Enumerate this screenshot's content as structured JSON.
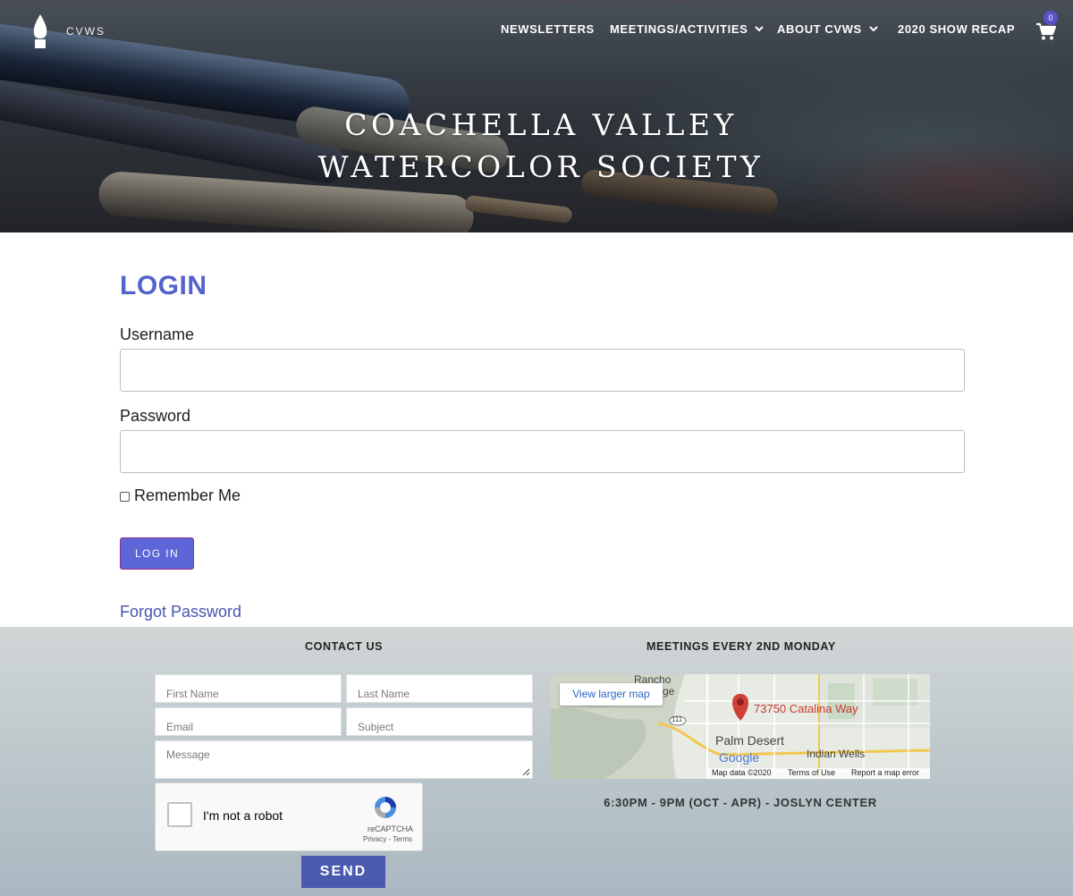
{
  "header": {
    "logo_text": "CVWS",
    "nav": [
      {
        "label": "NEWSLETTERS",
        "has_dropdown": false
      },
      {
        "label": "MEETINGS/ACTIVITIES",
        "has_dropdown": true
      },
      {
        "label": "ABOUT CVWS",
        "has_dropdown": true
      },
      {
        "label": "2020 SHOW RECAP",
        "has_dropdown": false
      }
    ],
    "cart_count": "0",
    "title_line1": "COACHELLA VALLEY",
    "title_line2": "WATERCOLOR SOCIETY"
  },
  "login": {
    "title": "LOGIN",
    "username_label": "Username",
    "username_value": "",
    "password_label": "Password",
    "password_value": "",
    "remember_label": "Remember Me",
    "remember_checked": false,
    "button_label": "LOG IN",
    "forgot_label": "Forgot Password"
  },
  "footer": {
    "contact_heading": "CONTACT US",
    "fields": {
      "first_name": "First Name",
      "last_name": "Last Name",
      "email": "Email",
      "subject": "Subject",
      "message": "Message"
    },
    "recaptcha": {
      "label": "I'm not a robot",
      "brand": "reCAPTCHA",
      "links": "Privacy - Terms"
    },
    "send_label": "SEND",
    "meetings_heading": "MEETINGS EVERY 2ND MONDAY",
    "map": {
      "view_larger": "View larger map",
      "address": "73750 Catalina Way",
      "city_palm_desert": "Palm Desert",
      "city_indian_wells": "Indian Wells",
      "city_rancho": "Rancho",
      "rancho_partial": "ge",
      "highway": "111",
      "google": "Google",
      "map_data": "Map data ©2020",
      "terms": "Terms of Use",
      "report": "Report a map error"
    },
    "meeting_time": "6:30PM - 9PM (OCT - APR) - JOSLYN CENTER"
  },
  "colors": {
    "login_title": "#5463cc",
    "login_button": "#5c66d6",
    "send_button": "#4a5aaf",
    "link": "#4656b0",
    "cart_badge": "#5b52c9"
  }
}
